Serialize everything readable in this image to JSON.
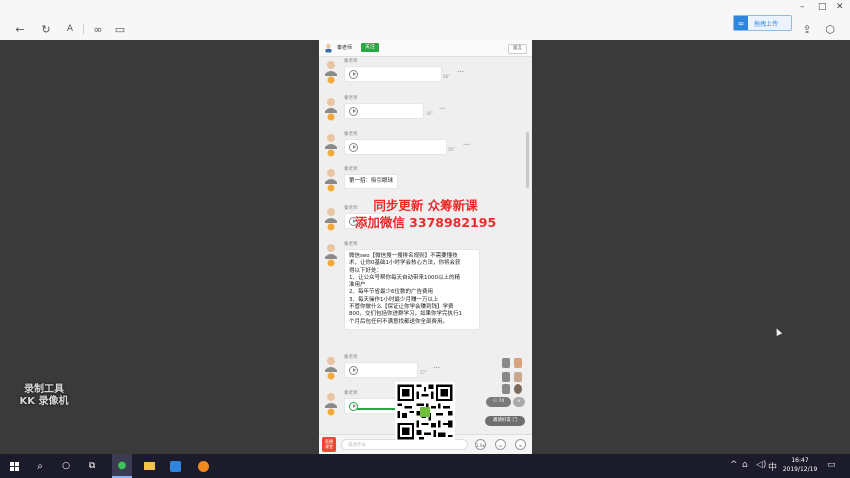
{
  "window": {
    "upload_label": "拖拽上传",
    "minimize": "–",
    "maximize": "□",
    "close": "✕"
  },
  "toolbar": {
    "back": "←",
    "refresh": "↻",
    "font": "A",
    "link": "∞",
    "save": "▭"
  },
  "recorder_watermark": [
    "录制工具",
    "KK 录像机"
  ],
  "chat": {
    "header_name": "秦老师",
    "follow_label": "关注",
    "right_button": "留言",
    "sender": "秦老师",
    "messages": [
      {
        "type": "voice",
        "duration": "56\"",
        "dots": "•••"
      },
      {
        "type": "voice",
        "duration": "36\"",
        "dots": "•••"
      },
      {
        "type": "voice",
        "duration": "56\"",
        "dots": "•••"
      },
      {
        "type": "text",
        "text": "第一招：吸引眼球"
      },
      {
        "type": "voice",
        "duration": "",
        "dots": ""
      },
      {
        "type": "text_long",
        "lines": [
          "微信seo【微信搜一搜排名规则】不需要懂技",
          "术，让你0基础1小时学会核心方法，你将会获",
          "得以下好处：",
          "1、让公众号帮你每天自动带来1000以上的精",
          "准用户",
          "2、每年节省最少6位数的广告费用",
          "3、每天操作1小时最少月赚一万以上",
          "不管你做什么【保证让你学会赚到钱】学费",
          "800，交们包括你进群学习，如果你学完执行1",
          "个月后包任何不满意找都送你全部费用。"
        ]
      },
      {
        "type": "voice",
        "duration": "57\"",
        "dots": "•••"
      },
      {
        "type": "voice_playing",
        "duration": "",
        "dots": ""
      }
    ],
    "promo_line1": "同步更新 众筹新课",
    "promo_line2": "添加微信 3378982195",
    "online_count": "74",
    "invite_label": "邀请好友 门",
    "comment_placeholder": "说点什么",
    "speed_label": "1.0x",
    "bottom_left_icon": "直播\n课堂"
  },
  "taskbar": {
    "time": "16:47",
    "date": "2019/12/19",
    "ime": "中"
  },
  "colors": {
    "accent_blue": "#2f86e0",
    "follow_green": "#27a844",
    "promo_red": "#ea2a2a",
    "stage_bg": "#3a3a3a",
    "taskbar_bg": "#1b1b2b"
  }
}
